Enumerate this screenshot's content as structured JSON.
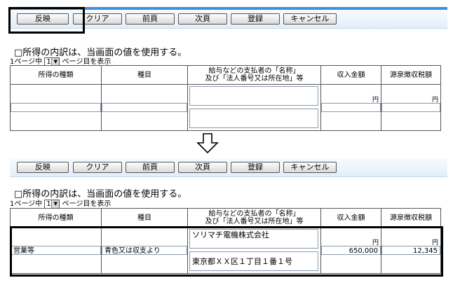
{
  "toolbar": {
    "buttons": [
      "反映",
      "クリア",
      "前頁",
      "次頁",
      "登録",
      "キャンセル"
    ]
  },
  "option": {
    "checkbox_label": "□所得の内訳は、当画面の値を使用する。",
    "page_prefix": "1ページ中",
    "page_value": "1",
    "page_suffix": "ページ目を表示"
  },
  "table": {
    "headers": {
      "income_type": "所得の種類",
      "category": "種目",
      "payer_line1": "給与などの支払者の「名称」",
      "payer_line2": "及び「法人番号又は所在地」等",
      "income_amount": "収入金額",
      "withholding": "源泉徴収税額"
    },
    "yen": "円"
  },
  "before": {
    "income_type": "",
    "category": "",
    "payer_name": "",
    "payer_address": "",
    "income_amount": "",
    "withholding": ""
  },
  "after": {
    "income_type": "営業等",
    "category": "青色又は収支より",
    "payer_name": "ソリマチ電機株式会社",
    "payer_address": "東京都ＸＸ区１丁目１番１号",
    "income_amount": "650,000",
    "withholding": "12,345"
  },
  "colors": {
    "accent_line": "#3e8fe0",
    "highlight_frame": "#000000"
  }
}
